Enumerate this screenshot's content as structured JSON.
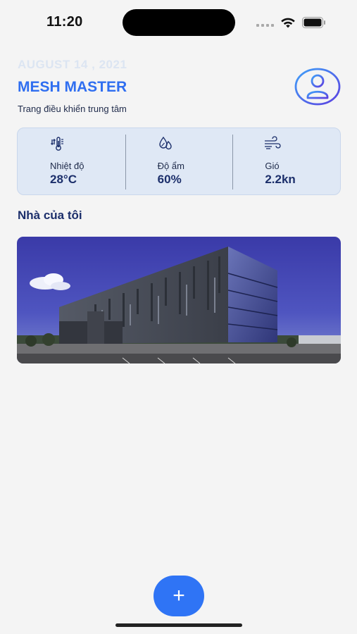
{
  "status_bar": {
    "time": "11:20",
    "icons": [
      "cellular-signal-icon",
      "wifi-icon",
      "battery-icon"
    ]
  },
  "header": {
    "date": "AUGUST 14 , 2021",
    "title": "MESH MASTER",
    "subtitle": "Trang điều khiển trung tâm",
    "avatar_icon": "user-profile-icon"
  },
  "stats": [
    {
      "icon": "thermometer-icon",
      "label": "Nhiệt độ",
      "value": "28°C"
    },
    {
      "icon": "humidity-drops-icon",
      "label": "Độ ẩm",
      "value": "60%"
    },
    {
      "icon": "wind-icon",
      "label": "Gió",
      "value": "2.2kn"
    }
  ],
  "section": {
    "title": "Nhà của tôi"
  },
  "home_card": {
    "image": "modern-office-building-photo"
  },
  "fab": {
    "label": "+",
    "icon": "plus-icon"
  },
  "colors": {
    "accent": "#2f74f5",
    "title_blue": "#2f6ef0",
    "dark_navy": "#1c2f6b",
    "card_bg": "#dfe8f5",
    "background": "#f4f4f4"
  }
}
